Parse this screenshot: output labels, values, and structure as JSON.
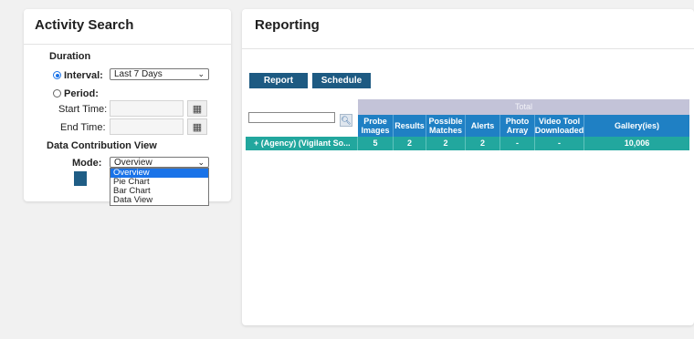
{
  "activity_search": {
    "title": "Activity Search",
    "duration_heading": "Duration",
    "interval_label": "Interval:",
    "interval_value": "Last 7 Days",
    "period_label": "Period:",
    "start_time_label": "Start Time:",
    "end_time_label": "End Time:",
    "data_contribution_heading": "Data Contribution View",
    "mode_label": "Mode:",
    "mode_value": "Overview",
    "mode_options": [
      "Overview",
      "Pie Chart",
      "Bar Chart",
      "Data View"
    ],
    "icons": {
      "select_chevron": "chevron-down-icon",
      "calendar": "calendar-icon"
    }
  },
  "reporting": {
    "title": "Reporting",
    "report_button": "Report",
    "schedule_button": "Schedule",
    "search_icon": "search-icon",
    "table": {
      "total_label": "Total",
      "columns": [
        "Probe Images",
        "Results",
        "Possible Matches",
        "Alerts",
        "Photo Array",
        "Video Tool Downloaded",
        "Gallery(ies)"
      ],
      "rows": [
        {
          "name": "+ (Agency) (Vigilant So...",
          "cells": [
            "5",
            "2",
            "2",
            "2",
            "-",
            "-",
            "10,006"
          ]
        }
      ]
    },
    "colors": {
      "header_blue": "#1f80c4",
      "row_teal": "#22a79e",
      "button_navy": "#1d5a82",
      "total_band": "#c3c3d8"
    }
  }
}
